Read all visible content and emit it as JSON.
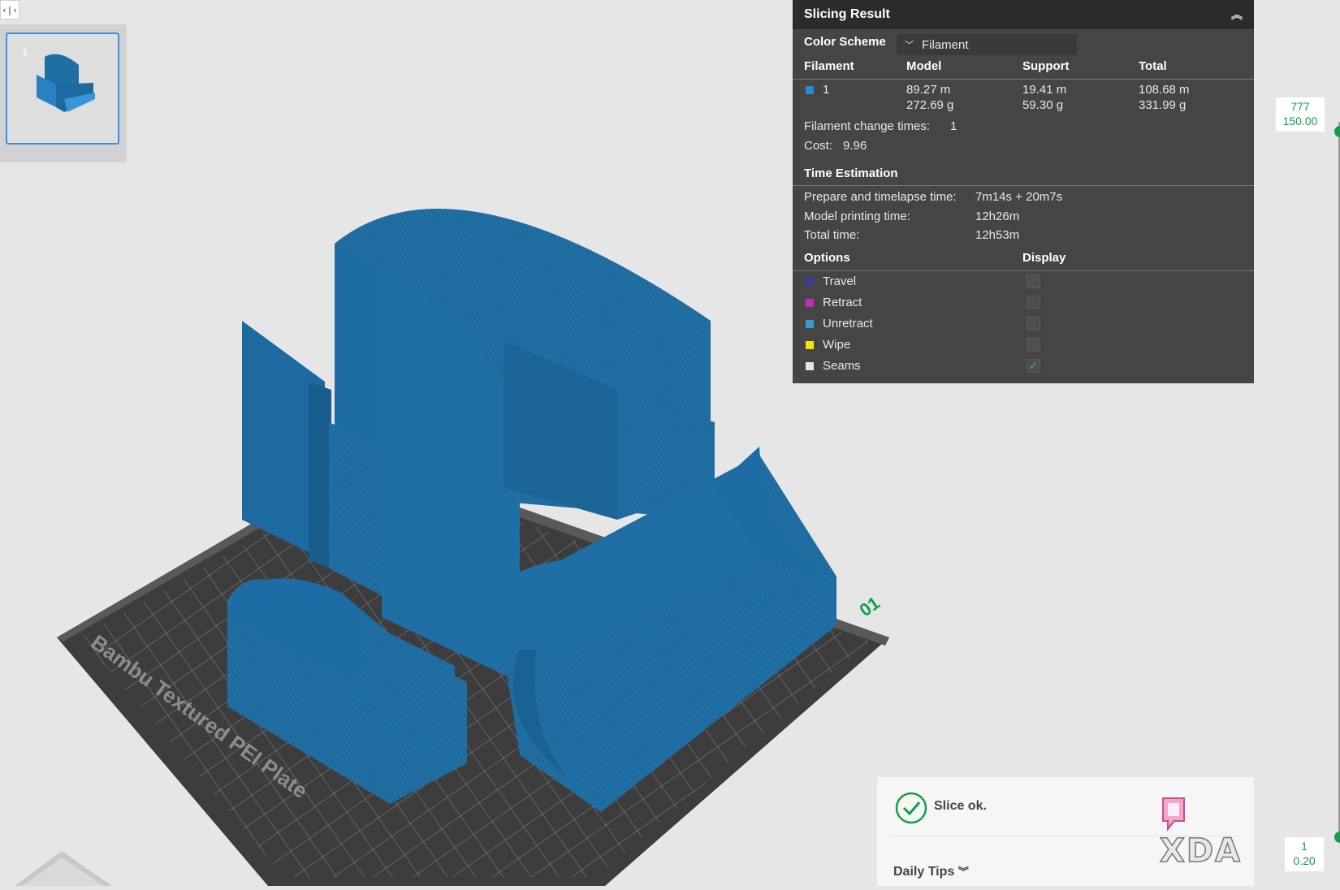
{
  "thumbnail": {
    "plate_number": "1"
  },
  "viewport": {
    "plate_name": "Bambu Textured PEI Plate",
    "plate_index": "01",
    "model_color": "#1f6fa5",
    "plate_color": "#3d3d3d"
  },
  "panel": {
    "title": "Slicing Result",
    "color_scheme_label": "Color Scheme",
    "color_scheme_value": "Filament",
    "columns": [
      "Filament",
      "Model",
      "Support",
      "Total"
    ],
    "filament_row": {
      "id": "1",
      "color": "#2a8ad0",
      "model_length": "89.27 m",
      "model_weight": "272.69 g",
      "support_length": "19.41 m",
      "support_weight": "59.30 g",
      "total_length": "108.68 m",
      "total_weight": "331.99 g"
    },
    "change_times_label": "Filament change times:",
    "change_times_value": "1",
    "cost_label": "Cost:",
    "cost_value": "9.96",
    "time_title": "Time Estimation",
    "time_rows": [
      {
        "label": "Prepare and timelapse time:",
        "value": "7m14s + 20m7s"
      },
      {
        "label": "Model printing time:",
        "value": "12h26m"
      },
      {
        "label": "Total time:",
        "value": "12h53m"
      }
    ],
    "options_label": "Options",
    "display_label": "Display",
    "options": [
      {
        "label": "Travel",
        "color": "#3a3f9a",
        "checked": false
      },
      {
        "label": "Retract",
        "color": "#c02ec0",
        "checked": false
      },
      {
        "label": "Unretract",
        "color": "#3a9ad0",
        "checked": false
      },
      {
        "label": "Wipe",
        "color": "#f2e600",
        "checked": false
      },
      {
        "label": "Seams",
        "color": "#e6e6e6",
        "checked": true
      }
    ]
  },
  "layer_slider": {
    "top_layer": "777",
    "top_height": "150.00",
    "bottom_layer": "1",
    "bottom_height": "0.20"
  },
  "status": {
    "message": "Slice ok.",
    "tips": "Daily Tips",
    "watermark": "XDA"
  }
}
